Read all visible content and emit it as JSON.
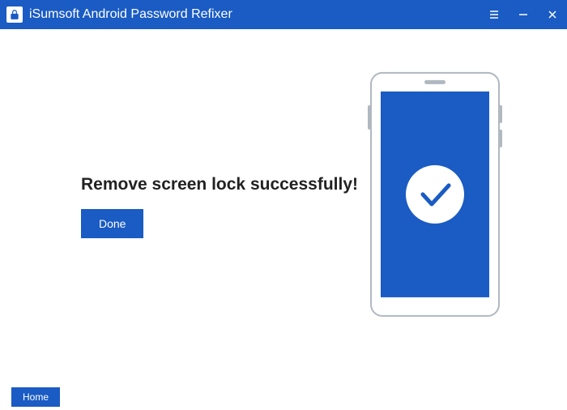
{
  "titlebar": {
    "app_title": "iSumsoft Android Password Refixer"
  },
  "main": {
    "heading": "Remove screen lock successfully!",
    "done_label": "Done"
  },
  "footer": {
    "home_label": "Home"
  },
  "colors": {
    "accent": "#1a5bc4"
  }
}
